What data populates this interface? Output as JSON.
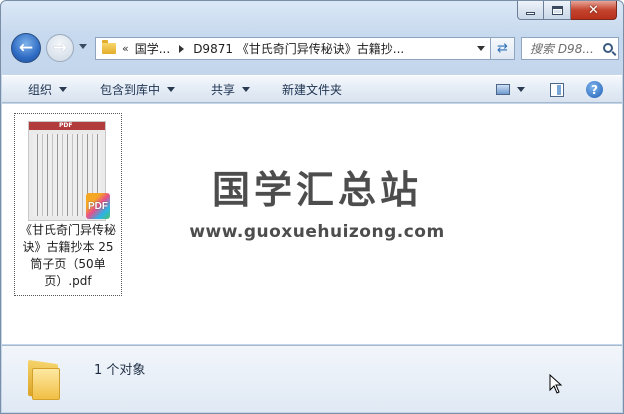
{
  "window": {
    "controls": {
      "minimize": "—",
      "maximize": "□",
      "close": "✕"
    }
  },
  "nav": {
    "back_icon": "back-arrow-icon",
    "forward_icon": "forward-arrow-icon",
    "address": {
      "overflow": "«",
      "crumbs": [
        "国学...",
        "D9871 《甘氏奇门异传秘诀》古籍抄..."
      ]
    },
    "search_placeholder": "搜索 D98..."
  },
  "toolbar": {
    "organize": "组织",
    "include_library": "包含到库中",
    "share": "共享",
    "new_folder": "新建文件夹",
    "help": "?"
  },
  "file": {
    "name": "《甘氏奇门异传秘诀》古籍抄本 25筒子页（50单页）.pdf",
    "badge": "PDF",
    "thumb_header": "PDF"
  },
  "watermark": {
    "title": "国学汇总站",
    "url": "www.guoxuehuizong.com"
  },
  "status": {
    "object_count": "1 个对象"
  },
  "colors": {
    "chrome": "#c7d9ee",
    "close": "#c4442e",
    "watermark": "#4d4d4d"
  }
}
